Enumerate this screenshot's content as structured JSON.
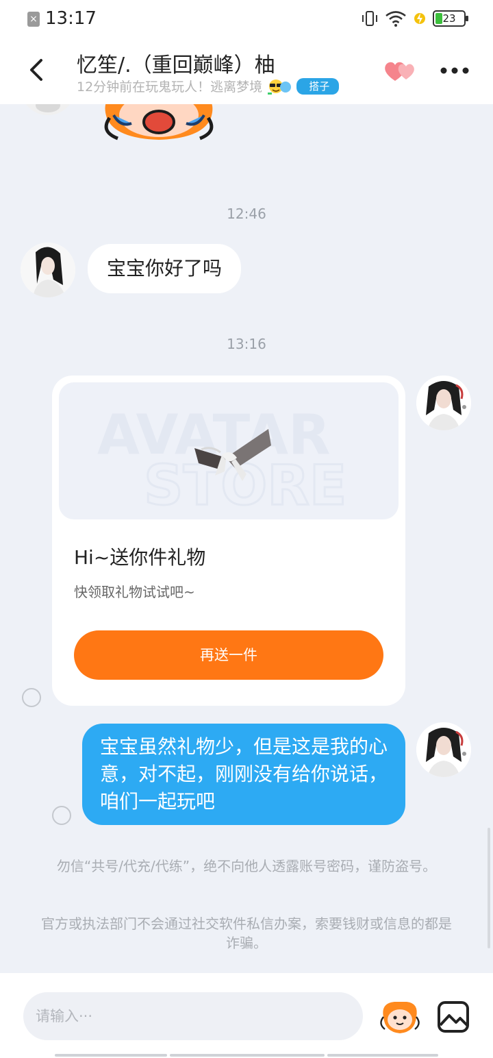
{
  "status_bar": {
    "time": "13:17",
    "battery": "23",
    "close_glyph": "×"
  },
  "header": {
    "title": "忆笙/.（重回巅峰）柚",
    "subtitle": "12分钟前在玩鬼玩人！逃离梦境",
    "tag": "搭子",
    "icons": [
      "back-arrow-icon",
      "sunglasses-emoji-icon",
      "hearts-icon",
      "more-icon"
    ]
  },
  "chat": {
    "messages": [
      {
        "type": "timestamp",
        "text": "12:46"
      },
      {
        "type": "text",
        "side": "left",
        "text": "宝宝你好了吗"
      },
      {
        "type": "timestamp",
        "text": "13:16"
      },
      {
        "type": "gift",
        "side": "right",
        "watermark_line1": "AVATAR",
        "watermark_line2": "STORE",
        "title": "Hi~送你件礼物",
        "subtitle": "快领取礼物试试吧~",
        "button": "再送一件"
      },
      {
        "type": "text",
        "side": "right",
        "text": "宝宝虽然礼物少，但是这是我的心意，对不起，刚刚没有给你说话，咱们一起玩吧"
      }
    ],
    "notices": [
      "勿信“共号/代充/代练”，绝不向他人透露账号密码，谨防盗号。",
      "官方或执法部门不会通过社交软件私信办案，索要钱财或信息的都是诈骗。"
    ]
  },
  "input": {
    "placeholder": "请输入···",
    "icons": [
      "mascot-emoji-icon",
      "image-icon"
    ]
  },
  "colors": {
    "accent_orange": "#ff7714",
    "bubble_blue": "#2daaf3",
    "tag_blue": "#2ba5e6",
    "background": "#eef1f7"
  }
}
